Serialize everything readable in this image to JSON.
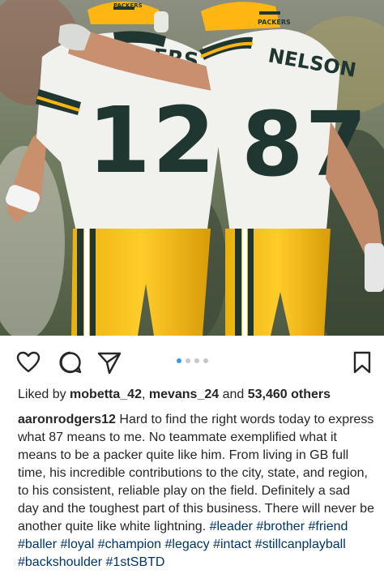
{
  "post": {
    "image_description": "Two Green Bay Packers players, numbers 12 and 87, walking off the field with arms around each other",
    "jersey_left": {
      "name": "ERS",
      "number": "12"
    },
    "jersey_right": {
      "name": "NELSON",
      "number": "87"
    },
    "helmet_text": "PACKERS"
  },
  "carousel": {
    "total": 4,
    "active_index": 0
  },
  "icons": [
    "heart-icon",
    "comment-icon",
    "share-icon",
    "bookmark-icon"
  ],
  "likes": {
    "prefix": "Liked by ",
    "user1": "mobetta_42",
    "sep": ", ",
    "user2": "mevans_24",
    "mid": " and ",
    "count": "53,460 others"
  },
  "caption": {
    "username": "aaronrodgers12",
    "text": " Hard to find the right words today to express what 87 means to me. No teammate exemplified what it means to be a packer quite like him. From living in GB full time, his incredible contributions to the city, state, and region, to his consistent, reliable play on the field. Definitely a sad day and the toughest part of this business. There will never be another quite like white lightning. ",
    "hashtags": [
      "#leader",
      "#brother",
      "#friend",
      "#baller",
      "#loyal",
      "#champion",
      "#legacy",
      "#intact",
      "#stillcanplayball",
      "#backshoulder",
      "#1stSBTD"
    ]
  },
  "colors": {
    "packers_green": "#203731",
    "packers_gold": "#FFB612",
    "link": "#003569",
    "dot_active": "#3897f0",
    "dot_inactive": "#c7c7c7"
  }
}
